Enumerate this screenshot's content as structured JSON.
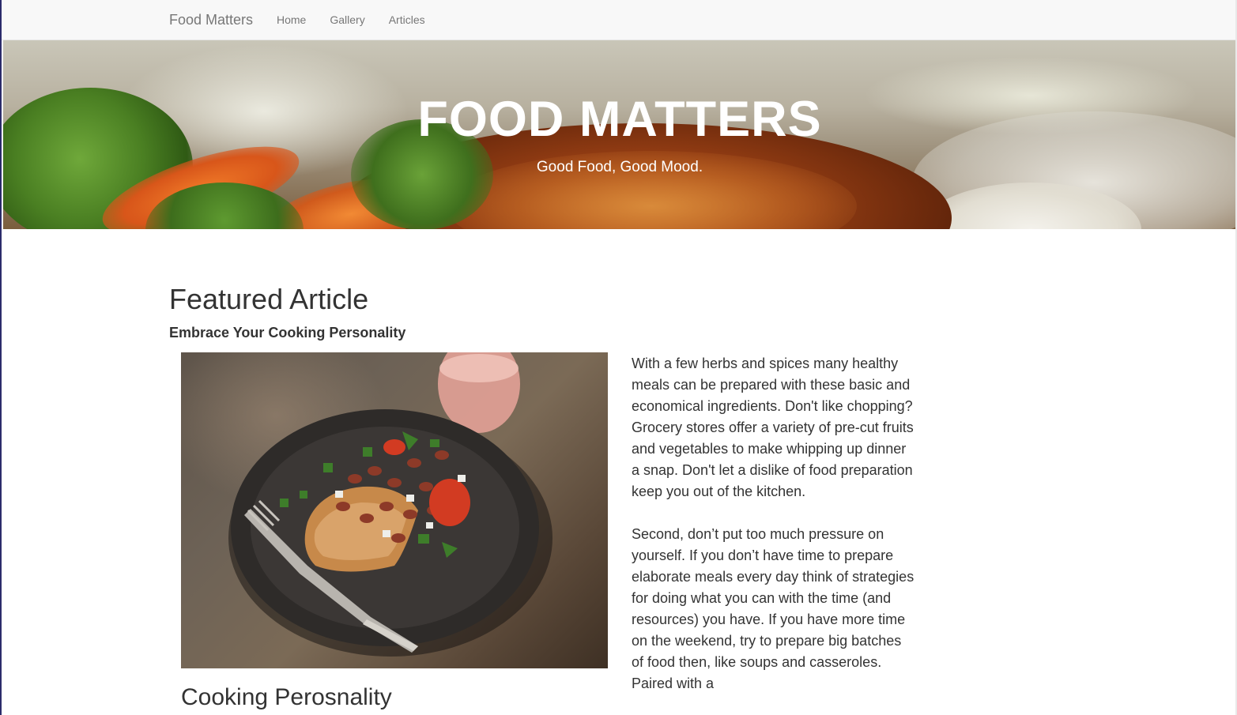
{
  "navbar": {
    "brand": "Food Matters",
    "links": [
      {
        "label": "Home"
      },
      {
        "label": "Gallery"
      },
      {
        "label": "Articles"
      }
    ]
  },
  "hero": {
    "title": "FOOD MATTERS",
    "subtitle": "Good Food, Good Mood."
  },
  "main": {
    "section_heading": "Featured Article",
    "article_title": "Embrace Your Cooking Personality",
    "image_caption_heading": "Cooking Perosnality",
    "paragraphs": [
      "With a few herbs and spices many healthy meals can be prepared with these basic and economical ingredients. Don't like chopping? Grocery stores offer a variety of pre-cut fruits and vegetables to make whipping up dinner a snap. Don't let a dislike of food preparation keep you out of the kitchen.",
      "Second, don’t put too much pressure on yourself. If you don’t have time to prepare elaborate meals every day think of strategies for doing what you can with the time (and resources) you have. If you have more time on the weekend, try to prepare big batches of food then, like soups and casseroles. Paired with a"
    ]
  },
  "colors": {
    "navbar_bg": "#f8f8f8",
    "nav_text": "#777777",
    "body_text": "#333333",
    "hero_text": "#ffffff"
  }
}
